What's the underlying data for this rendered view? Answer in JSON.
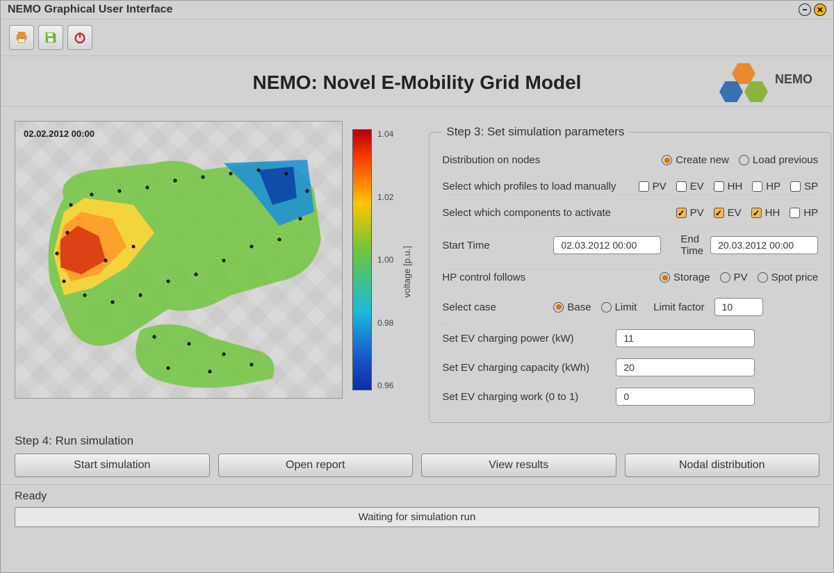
{
  "window_title": "NEMO Graphical User Interface",
  "header_title": "NEMO: Novel E-Mobility Grid Model",
  "logo_text": "NEMO",
  "toolbar": {
    "print": "print-icon",
    "save": "save-icon",
    "power": "power-icon"
  },
  "map": {
    "timestamp": "02.02.2012   00:00",
    "colorbar_label": "voltage [p.u.]",
    "ticks": [
      "1.04",
      "1.02",
      "1.00",
      "0.98",
      "0.96"
    ]
  },
  "step3": {
    "title": "Step 3: Set simulation parameters",
    "distribution_label": "Distribution on nodes",
    "distribution_opts": {
      "create_new": "Create new",
      "load_previous": "Load previous"
    },
    "distribution_selected": "create_new",
    "profiles_label": "Select which profiles to load manually",
    "profiles": [
      {
        "key": "PV",
        "checked": false
      },
      {
        "key": "EV",
        "checked": false
      },
      {
        "key": "HH",
        "checked": false
      },
      {
        "key": "HP",
        "checked": false
      },
      {
        "key": "SP",
        "checked": false
      }
    ],
    "activate_label": "Select which components to activate",
    "activate": [
      {
        "key": "PV",
        "checked": true
      },
      {
        "key": "EV",
        "checked": true
      },
      {
        "key": "HH",
        "checked": true
      },
      {
        "key": "HP",
        "checked": false
      }
    ],
    "start_time_label": "Start Time",
    "start_time": "02.03.2012   00:00",
    "end_time_label": "End Time",
    "end_time": "20.03.2012   00:00",
    "hp_label": "HP control follows",
    "hp_opts": {
      "storage": "Storage",
      "pv": "PV",
      "spot": "Spot price"
    },
    "hp_selected": "storage",
    "case_label": "Select case",
    "case_opts": {
      "base": "Base",
      "limit": "Limit"
    },
    "case_selected": "base",
    "limit_factor_label": "Limit factor",
    "limit_factor": "10",
    "ev_power_label": "Set EV charging power (kW)",
    "ev_power": "11",
    "ev_capacity_label": "Set EV charging capacity (kWh)",
    "ev_capacity": "20",
    "ev_work_label": "Set EV charging work (0 to 1)",
    "ev_work": "0"
  },
  "step4": {
    "title": "Step 4: Run simulation",
    "buttons": {
      "start": "Start simulation",
      "open_report": "Open report",
      "view_results": "View results",
      "nodal_distribution": "Nodal distribution"
    }
  },
  "status": {
    "label": "Ready",
    "message": "Waiting for simulation run"
  }
}
